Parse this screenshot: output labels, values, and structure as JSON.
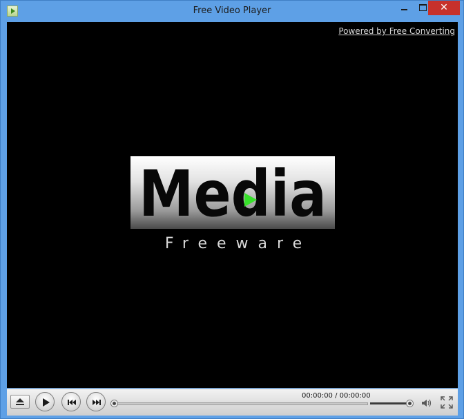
{
  "window": {
    "title": "Free Video Player"
  },
  "titlebar_buttons": {
    "close_glyph": "✕"
  },
  "video": {
    "powered_by": "Powered by Free Converting",
    "logo_word": "Media",
    "logo_subtitle": "Freeware",
    "colors": {
      "play_accent": "#37e12a"
    }
  },
  "controls": {
    "time_display": "00:00:00 / 00:00:00",
    "seek_progress_fraction": 0.0,
    "volume_fraction": 1.0,
    "icons": [
      "eject-icon",
      "play-icon",
      "previous-track-icon",
      "next-track-icon",
      "volume-icon",
      "fullscreen-icon"
    ]
  }
}
